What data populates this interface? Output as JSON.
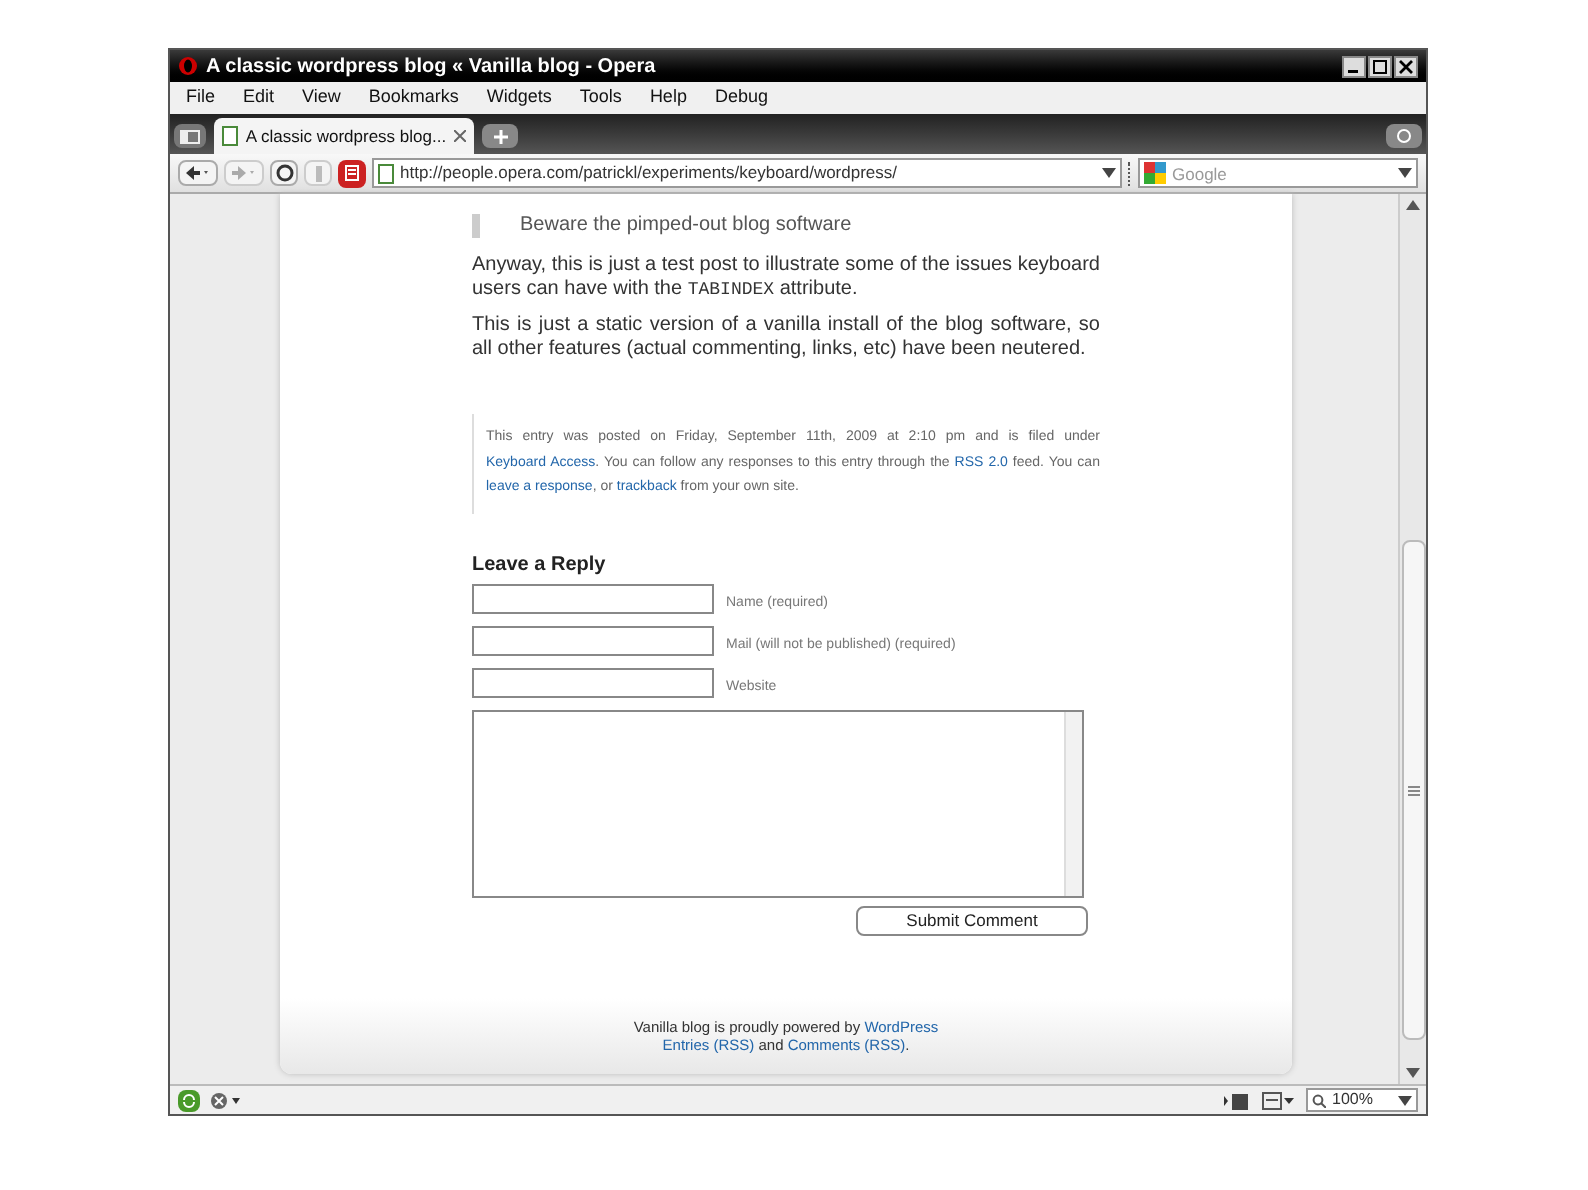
{
  "window": {
    "title": "A classic wordpress blog « Vanilla blog - Opera"
  },
  "menu": [
    "File",
    "Edit",
    "View",
    "Bookmarks",
    "Widgets",
    "Tools",
    "Help",
    "Debug"
  ],
  "tabs": [
    {
      "label": "A classic wordpress blog...",
      "selected": true
    }
  ],
  "toolbar": {
    "address": "http://people.opera.com/patrickl/experiments/keyboard/wordpress/",
    "search": {
      "placeholder": "Google"
    }
  },
  "post": {
    "blockquote": "Beware the pimped-out blog software",
    "paragraphs": [
      [
        {
          "kind": "text",
          "text": "Anyway, this is just a test post to illustrate some of the issues keyboard users can have with the "
        },
        {
          "kind": "code",
          "text": "TABINDEX"
        },
        {
          "kind": "text",
          "text": " attribute."
        }
      ],
      [
        {
          "kind": "text",
          "text": "This is just a static version of a vanilla install of the blog software, so all other features (actual commenting, links, etc) have been neutered."
        }
      ]
    ],
    "meta": [
      {
        "kind": "text",
        "text": "This entry was posted on Friday, September 11th, 2009 at 2:10 pm and is filed under "
      },
      {
        "kind": "link",
        "text": "Keyboard Access"
      },
      {
        "kind": "text",
        "text": ". You can follow any responses to this entry through the "
      },
      {
        "kind": "link",
        "text": "RSS 2.0"
      },
      {
        "kind": "text",
        "text": " feed. You can "
      },
      {
        "kind": "link",
        "text": "leave a response"
      },
      {
        "kind": "text",
        "text": ", or "
      },
      {
        "kind": "link",
        "text": "trackback"
      },
      {
        "kind": "text",
        "text": " from your own site."
      }
    ]
  },
  "reply": {
    "title": "Leave a Reply",
    "fields": [
      {
        "label": "Name (required)"
      },
      {
        "label": "Mail (will not be published) (required)"
      },
      {
        "label": "Website"
      }
    ],
    "submit": "Submit Comment"
  },
  "footer": [
    [
      {
        "kind": "text",
        "text": "Vanilla blog is proudly powered by "
      },
      {
        "kind": "link",
        "text": "WordPress"
      }
    ],
    [
      {
        "kind": "link",
        "text": "Entries (RSS)"
      },
      {
        "kind": "text",
        "text": " and "
      },
      {
        "kind": "link",
        "text": "Comments (RSS)"
      },
      {
        "kind": "text",
        "text": "."
      }
    ]
  ],
  "status_bar": {
    "zoom": "100%"
  }
}
